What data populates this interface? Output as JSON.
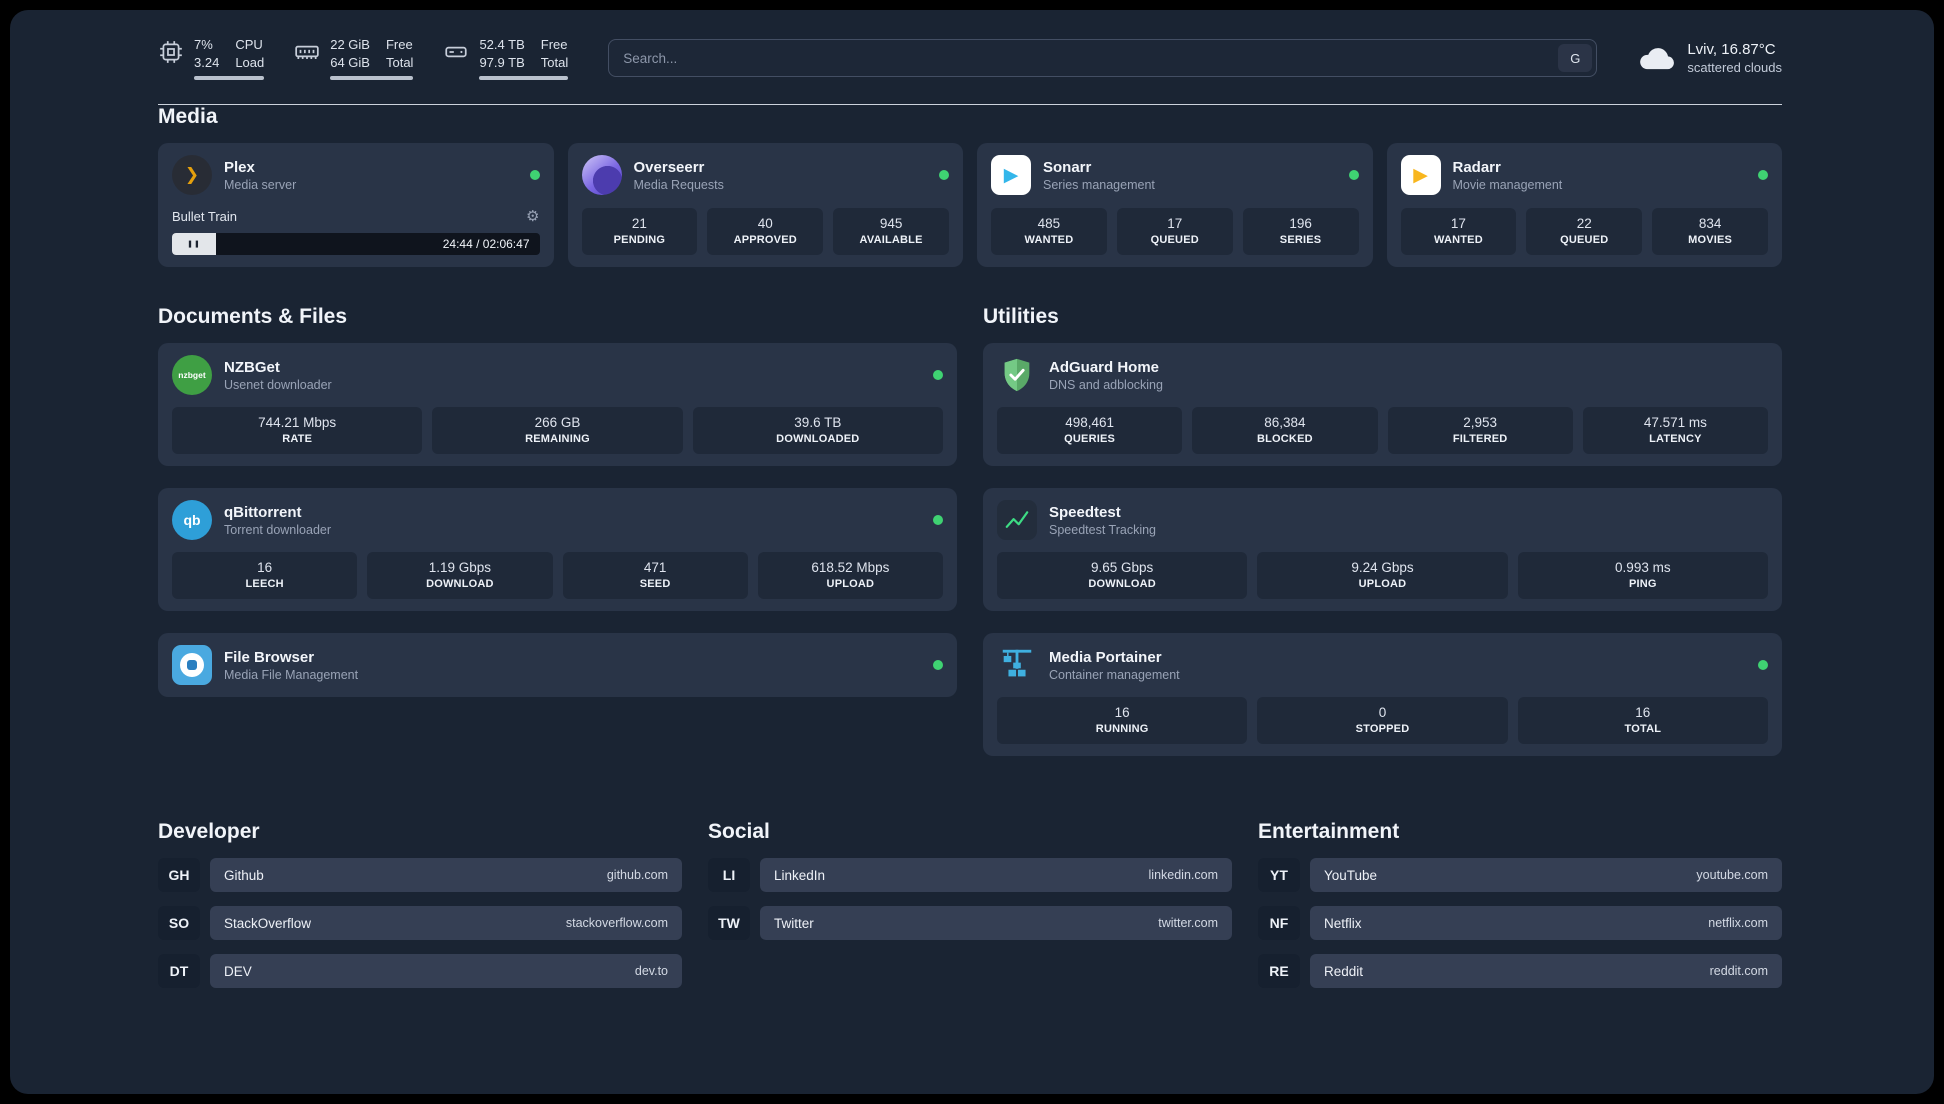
{
  "colors": {
    "status_online": "#3fd272",
    "plex": "#e5a00d",
    "overseerr": "#7a66e3",
    "sonarr": "#33b6ea",
    "radarr": "#f8b61e",
    "nzbget": "#3f9f44",
    "qbittorrent": "#2e9fd8",
    "filebrowser": "#4aa9e0",
    "adguard": "#67b678",
    "speedtest_line": "#3ddc84",
    "portainer": "#3fb0e0"
  },
  "icons": {
    "gear": "⚙",
    "pause": "❚❚",
    "plex_chevron": "❯",
    "sonarr_play": "▶",
    "radarr_play": "▶",
    "qbittorrent_glyph": "qb",
    "nzbget_glyph": "nzbget",
    "search_engine": "G"
  },
  "topbar": {
    "metrics": [
      {
        "name": "cpu",
        "val1": "7%",
        "val2": "3.24",
        "lab1": "CPU",
        "lab2": "Load"
      },
      {
        "name": "memory",
        "val1": "22 GiB",
        "val2": "64 GiB",
        "lab1": "Free",
        "lab2": "Total"
      },
      {
        "name": "storage",
        "val1": "52.4 TB",
        "val2": "97.9 TB",
        "lab1": "Free",
        "lab2": "Total"
      }
    ],
    "search": {
      "placeholder": "Search..."
    },
    "weather": {
      "location": "Lviv, 16.87°C",
      "condition": "scattered clouds"
    }
  },
  "media": {
    "title": "Media",
    "plex": {
      "name": "Plex",
      "subtitle": "Media server",
      "now_playing": "Bullet Train",
      "time": "24:44 / 02:06:47"
    },
    "overseerr": {
      "name": "Overseerr",
      "subtitle": "Media Requests",
      "stats": [
        {
          "value": "21",
          "label": "PENDING"
        },
        {
          "value": "40",
          "label": "APPROVED"
        },
        {
          "value": "945",
          "label": "AVAILABLE"
        }
      ]
    },
    "sonarr": {
      "name": "Sonarr",
      "subtitle": "Series management",
      "stats": [
        {
          "value": "485",
          "label": "WANTED"
        },
        {
          "value": "17",
          "label": "QUEUED"
        },
        {
          "value": "196",
          "label": "SERIES"
        }
      ]
    },
    "radarr": {
      "name": "Radarr",
      "subtitle": "Movie management",
      "stats": [
        {
          "value": "17",
          "label": "WANTED"
        },
        {
          "value": "22",
          "label": "QUEUED"
        },
        {
          "value": "834",
          "label": "MOVIES"
        }
      ]
    }
  },
  "documents": {
    "title": "Documents & Files",
    "nzbget": {
      "name": "NZBGet",
      "subtitle": "Usenet downloader",
      "stats": [
        {
          "value": "744.21 Mbps",
          "label": "RATE"
        },
        {
          "value": "266 GB",
          "label": "REMAINING"
        },
        {
          "value": "39.6 TB",
          "label": "DOWNLOADED"
        }
      ]
    },
    "qbittorrent": {
      "name": "qBittorrent",
      "subtitle": "Torrent downloader",
      "stats": [
        {
          "value": "16",
          "label": "LEECH"
        },
        {
          "value": "1.19 Gbps",
          "label": "DOWNLOAD"
        },
        {
          "value": "471",
          "label": "SEED"
        },
        {
          "value": "618.52 Mbps",
          "label": "UPLOAD"
        }
      ]
    },
    "filebrowser": {
      "name": "File Browser",
      "subtitle": "Media File Management"
    }
  },
  "utilities": {
    "title": "Utilities",
    "adguard": {
      "name": "AdGuard Home",
      "subtitle": "DNS and adblocking",
      "stats": [
        {
          "value": "498,461",
          "label": "QUERIES"
        },
        {
          "value": "86,384",
          "label": "BLOCKED"
        },
        {
          "value": "2,953",
          "label": "FILTERED"
        },
        {
          "value": "47.571 ms",
          "label": "LATENCY"
        }
      ]
    },
    "speedtest": {
      "name": "Speedtest",
      "subtitle": "Speedtest Tracking",
      "stats": [
        {
          "value": "9.65 Gbps",
          "label": "DOWNLOAD"
        },
        {
          "value": "9.24 Gbps",
          "label": "UPLOAD"
        },
        {
          "value": "0.993 ms",
          "label": "PING"
        }
      ]
    },
    "portainer": {
      "name": "Media Portainer",
      "subtitle": "Container management",
      "stats": [
        {
          "value": "16",
          "label": "RUNNING"
        },
        {
          "value": "0",
          "label": "STOPPED"
        },
        {
          "value": "16",
          "label": "TOTAL"
        }
      ]
    }
  },
  "bookmarks": [
    {
      "title": "Developer",
      "items": [
        {
          "abbr": "GH",
          "name": "Github",
          "url": "github.com"
        },
        {
          "abbr": "SO",
          "name": "StackOverflow",
          "url": "stackoverflow.com"
        },
        {
          "abbr": "DT",
          "name": "DEV",
          "url": "dev.to"
        }
      ]
    },
    {
      "title": "Social",
      "items": [
        {
          "abbr": "LI",
          "name": "LinkedIn",
          "url": "linkedin.com"
        },
        {
          "abbr": "TW",
          "name": "Twitter",
          "url": "twitter.com"
        }
      ]
    },
    {
      "title": "Entertainment",
      "items": [
        {
          "abbr": "YT",
          "name": "YouTube",
          "url": "youtube.com"
        },
        {
          "abbr": "NF",
          "name": "Netflix",
          "url": "netflix.com"
        },
        {
          "abbr": "RE",
          "name": "Reddit",
          "url": "reddit.com"
        }
      ]
    }
  ]
}
